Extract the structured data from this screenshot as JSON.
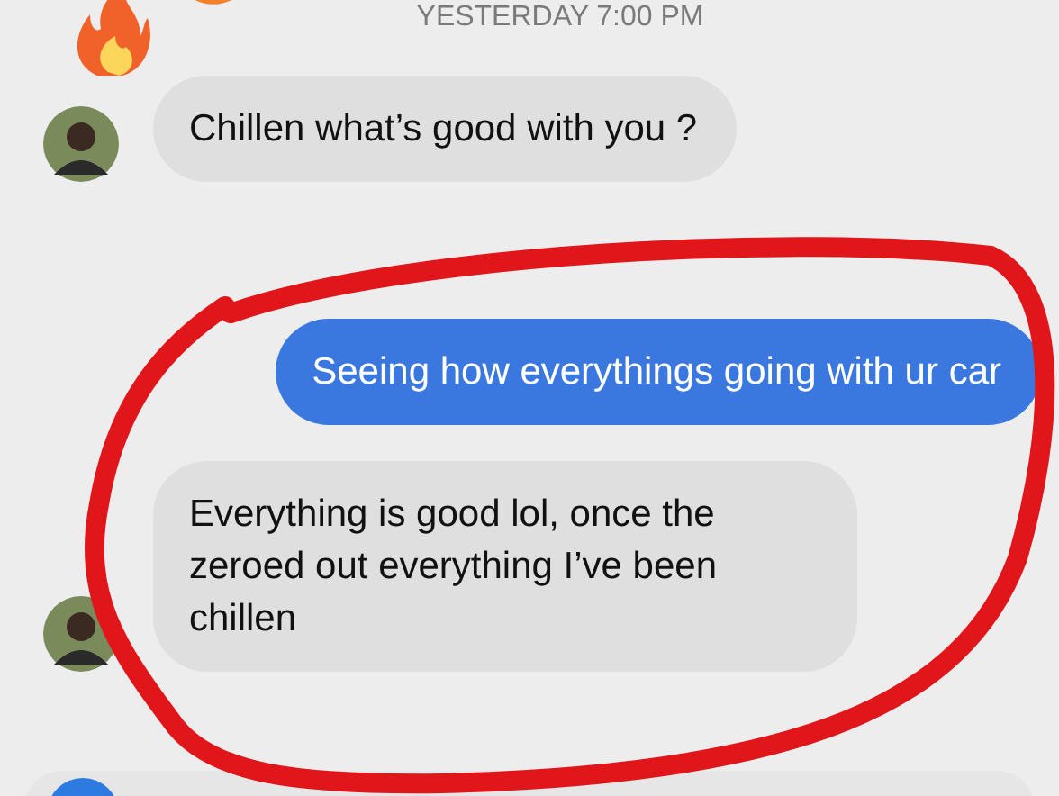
{
  "timestamp": "YESTERDAY 7:00 PM",
  "messages": [
    {
      "kind": "incoming",
      "text": "Chillen what’s good with you ?"
    },
    {
      "kind": "outgoing",
      "text": "Seeing how everythings going with ur car"
    },
    {
      "kind": "incoming",
      "text": "Everything is good lol, once the zeroed out everything I’ve been chillen"
    }
  ]
}
